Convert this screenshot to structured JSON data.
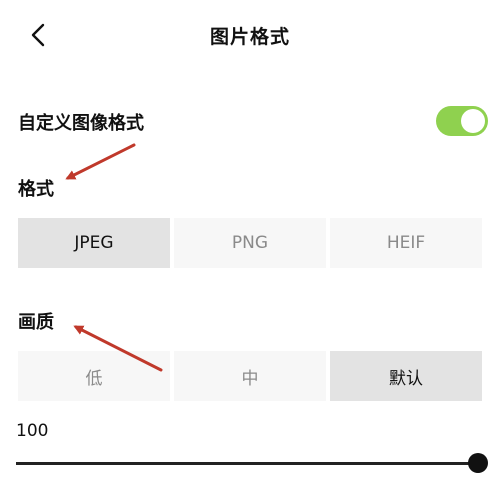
{
  "header": {
    "title": "图片格式",
    "back_icon": "chevron-left-icon"
  },
  "custom_format": {
    "label": "自定义图像格式",
    "enabled": true,
    "toggle_color": "#8fd14f"
  },
  "format": {
    "label": "格式",
    "options": [
      "JPEG",
      "PNG",
      "HEIF"
    ],
    "selected": "JPEG"
  },
  "quality": {
    "label": "画质",
    "options": [
      "低",
      "中",
      "默认"
    ],
    "selected": "默认",
    "value": "100",
    "slider_fraction": 1.0
  },
  "annotation_color": "#c0392b"
}
